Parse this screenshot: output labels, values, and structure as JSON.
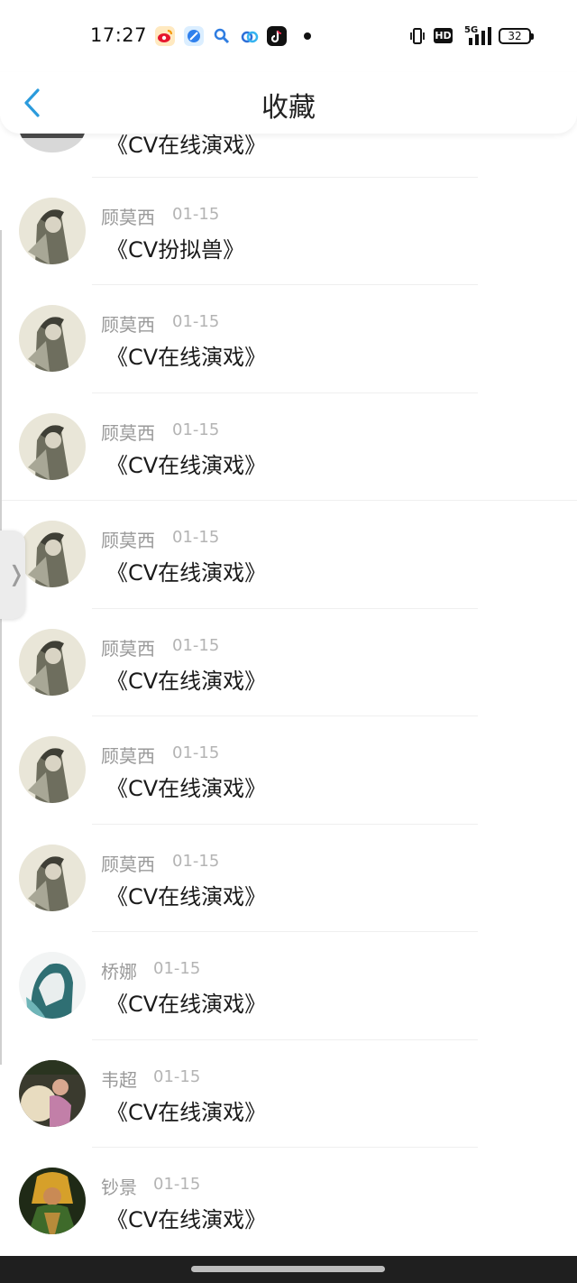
{
  "status_bar": {
    "time": "17:27",
    "apps": [
      "weibo-icon",
      "browser-icon",
      "search-app-icon",
      "baidu-netdisk-icon",
      "tiktok-icon"
    ],
    "hd_label": "HD",
    "network_label": "5G",
    "battery": "32"
  },
  "header": {
    "back_icon": "chevron-left-icon",
    "title": "收藏"
  },
  "list": {
    "partial_top_content": "《CV在线演戏》",
    "items": [
      {
        "author": "顾莫西",
        "date": "01-15",
        "content": "《CV扮拟兽》"
      },
      {
        "author": "顾莫西",
        "date": "01-15",
        "content": "《CV在线演戏》"
      },
      {
        "author": "顾莫西",
        "date": "01-15",
        "content": "《CV在线演戏》"
      },
      {
        "author": "顾莫西",
        "date": "01-15",
        "content": "《CV在线演戏》"
      },
      {
        "author": "顾莫西",
        "date": "01-15",
        "content": "《CV在线演戏》"
      },
      {
        "author": "顾莫西",
        "date": "01-15",
        "content": "《CV在线演戏》"
      },
      {
        "author": "顾莫西",
        "date": "01-15",
        "content": "《CV在线演戏》"
      },
      {
        "author": "桥娜",
        "date": "01-15",
        "content": "《CV在线演戏》"
      },
      {
        "author": "韦超",
        "date": "01-15",
        "content": "《CV在线演戏》"
      },
      {
        "author": "钞景",
        "date": "01-15",
        "content": "《CV在线演戏》"
      }
    ]
  },
  "side_handle_icon": "chevron-right-icon",
  "colors": {
    "accent": "#2b9bdc",
    "text_primary": "#1a1a1a",
    "text_secondary": "#9a9a9a"
  }
}
